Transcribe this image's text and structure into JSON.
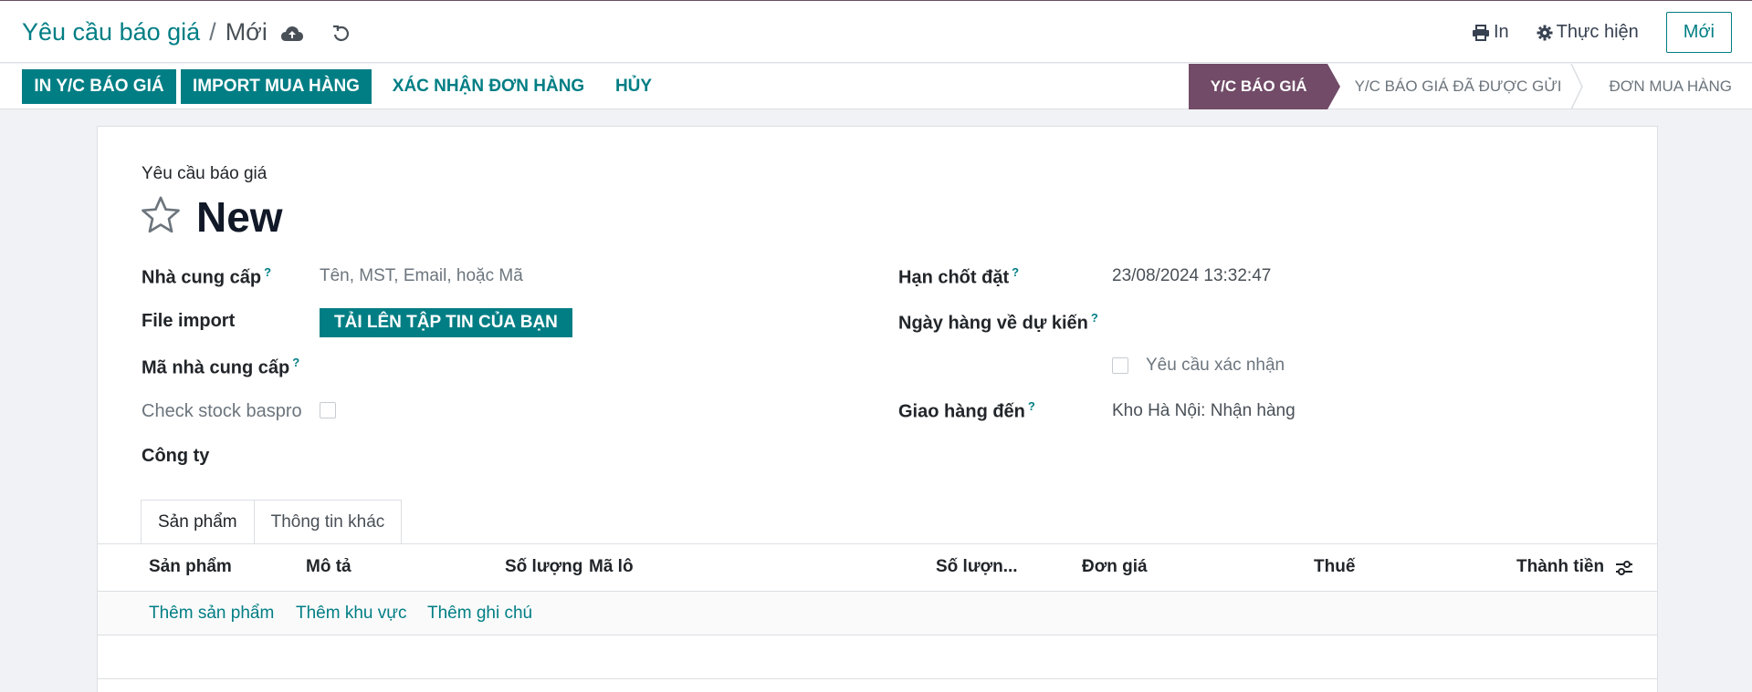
{
  "breadcrumb": {
    "parent": "Yêu cầu báo giá",
    "separator": "/",
    "current": "Mới"
  },
  "header_icons": {
    "save": "cloud-upload-icon",
    "discard": "undo-icon"
  },
  "header_actions": {
    "print_label": "In",
    "action_label": "Thực hiện",
    "new_label": "Mới"
  },
  "status_buttons": {
    "print_rfq": "IN Y/C BÁO GIÁ",
    "import_purchase": "IMPORT MUA HÀNG",
    "confirm_order": "XÁC NHẬN ĐƠN HÀNG",
    "cancel": "HỦY"
  },
  "stages": [
    "Y/C BÁO GIÁ",
    "Y/C BÁO GIÁ ĐÃ ĐƯỢC GỬI",
    "ĐƠN MUA HÀNG"
  ],
  "colors": {
    "accent": "#017e84",
    "brand": "#714b67"
  },
  "form": {
    "subtitle": "Yêu cầu báo giá",
    "title": "New",
    "left": {
      "vendor_label": "Nhà cung cấp",
      "vendor_placeholder": "Tên, MST, Email, hoặc Mã",
      "file_import_label": "File import",
      "upload_button": "TẢI LÊN TẬP TIN CỦA BẠN",
      "vendor_code_label": "Mã nhà cung cấp",
      "check_stock_label": "Check stock baspro",
      "company_label": "Công ty"
    },
    "right": {
      "deadline_label": "Hạn chốt đặt",
      "deadline_value": "23/08/2024 13:32:47",
      "expected_arrival_label": "Ngày hàng về dự kiến",
      "ask_confirmation_label": "Yêu cầu xác nhận",
      "deliver_to_label": "Giao hàng đến",
      "deliver_to_value": "Kho Hà Nội: Nhận hàng"
    },
    "help_mark": "?"
  },
  "tabs": [
    "Sản phẩm",
    "Thông tin khác"
  ],
  "table": {
    "columns": [
      "Sản phẩm",
      "Mô tả",
      "Số lượng",
      "Mã lô",
      "Số lượn...",
      "Đơn giá",
      "Thuế",
      "Thành tiền"
    ],
    "add_links": [
      "Thêm sản phẩm",
      "Thêm khu vực",
      "Thêm ghi chú"
    ]
  }
}
